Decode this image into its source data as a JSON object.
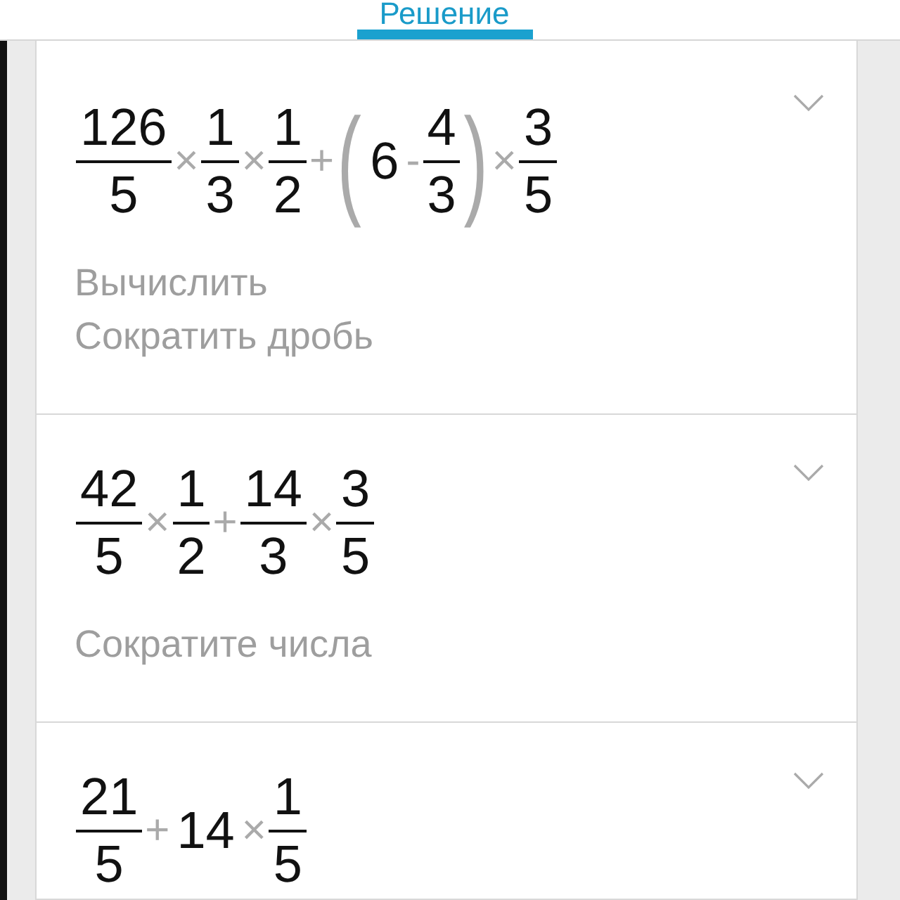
{
  "header": {
    "tabs": [
      {
        "label": "Решение",
        "selected": true
      }
    ]
  },
  "steps": [
    {
      "expanded": false,
      "expression": [
        {
          "kind": "frac",
          "num": "126",
          "den": "5"
        },
        {
          "kind": "op",
          "text": "×"
        },
        {
          "kind": "frac",
          "num": "1",
          "den": "3"
        },
        {
          "kind": "op",
          "text": "×"
        },
        {
          "kind": "frac",
          "num": "1",
          "den": "2"
        },
        {
          "kind": "op",
          "text": "+"
        },
        {
          "kind": "group",
          "open": "(",
          "close": ")",
          "items": [
            {
              "kind": "number",
              "text": "6"
            },
            {
              "kind": "op",
              "text": "-"
            },
            {
              "kind": "frac",
              "num": "4",
              "den": "3"
            }
          ]
        },
        {
          "kind": "op",
          "text": "×"
        },
        {
          "kind": "frac",
          "num": "3",
          "den": "5"
        }
      ],
      "hints": [
        "Вычислить",
        "Сократить дробь"
      ]
    },
    {
      "expanded": false,
      "expression": [
        {
          "kind": "frac",
          "num": "42",
          "den": "5"
        },
        {
          "kind": "op",
          "text": "×"
        },
        {
          "kind": "frac",
          "num": "1",
          "den": "2"
        },
        {
          "kind": "op",
          "text": "+"
        },
        {
          "kind": "frac",
          "num": "14",
          "den": "3"
        },
        {
          "kind": "op",
          "text": "×"
        },
        {
          "kind": "frac",
          "num": "3",
          "den": "5"
        }
      ],
      "hints": [
        "Сократите числа"
      ]
    },
    {
      "expanded": false,
      "expression": [
        {
          "kind": "frac",
          "num": "21",
          "den": "5"
        },
        {
          "kind": "op",
          "text": "+"
        },
        {
          "kind": "number",
          "text": "14"
        },
        {
          "kind": "op",
          "text": "×"
        },
        {
          "kind": "frac",
          "num": "1",
          "den": "5"
        }
      ]
    }
  ]
}
